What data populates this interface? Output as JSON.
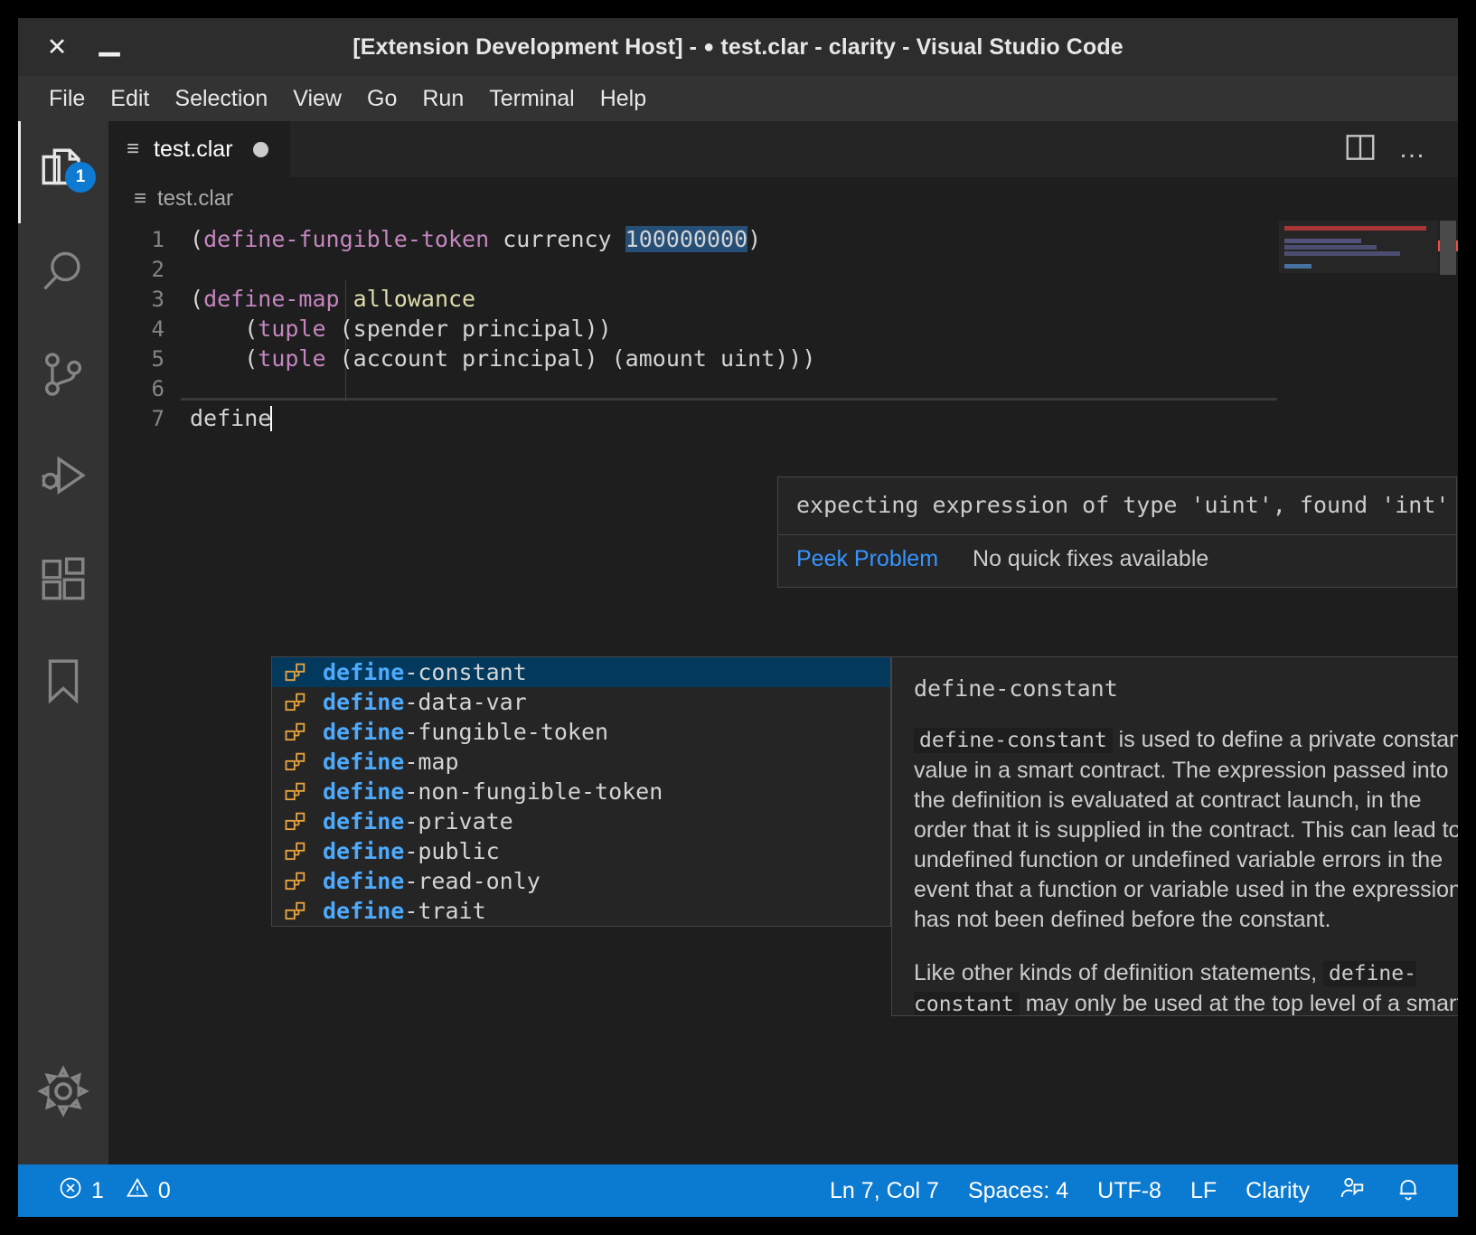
{
  "window": {
    "title_prefix": "[Extension Development Host] -",
    "dirty_marker": "●",
    "title_file": "test.clar - clarity - Visual Studio Code",
    "close_glyph": "✕",
    "minimize_glyph": "▁"
  },
  "menubar": {
    "items": [
      {
        "label": "File"
      },
      {
        "label": "Edit"
      },
      {
        "label": "Selection"
      },
      {
        "label": "View"
      },
      {
        "label": "Go"
      },
      {
        "label": "Run"
      },
      {
        "label": "Terminal"
      },
      {
        "label": "Help"
      }
    ]
  },
  "activitybar": {
    "items": [
      {
        "name": "explorer",
        "badge": "1"
      },
      {
        "name": "search",
        "badge": ""
      },
      {
        "name": "source-control",
        "badge": ""
      },
      {
        "name": "run-and-debug",
        "badge": ""
      },
      {
        "name": "extensions",
        "badge": ""
      },
      {
        "name": "bookmarks",
        "badge": ""
      }
    ],
    "bottom": [
      {
        "name": "manage-settings"
      }
    ]
  },
  "tabs": {
    "active": {
      "label": "test.clar",
      "dirty": true
    },
    "actions": {
      "split_editor": "split-editor-right",
      "more": "…"
    }
  },
  "breadcrumb": {
    "path": "test.clar"
  },
  "editor": {
    "lines": [
      {
        "no": "1",
        "text": "(define-fungible-token currency 100000000)"
      },
      {
        "no": "2",
        "text": ""
      },
      {
        "no": "3",
        "text": "(define-map allowance"
      },
      {
        "no": "4",
        "text": "    (tuple (spender principal))"
      },
      {
        "no": "5",
        "text": "    (tuple (account principal) (amount uint)))"
      },
      {
        "no": "6",
        "text": ""
      },
      {
        "no": "7",
        "text": "define"
      }
    ],
    "error_token": "100000000",
    "typed_prefix": "define"
  },
  "hover": {
    "message": "expecting expression of type 'uint', found 'int'",
    "peek_link": "Peek Problem",
    "quickfix_text": "No quick fixes available"
  },
  "suggest": {
    "items": [
      {
        "prefix": "define",
        "rest": "-constant",
        "selected": true
      },
      {
        "prefix": "define",
        "rest": "-data-var",
        "selected": false
      },
      {
        "prefix": "define",
        "rest": "-fungible-token",
        "selected": false
      },
      {
        "prefix": "define",
        "rest": "-map",
        "selected": false
      },
      {
        "prefix": "define",
        "rest": "-non-fungible-token",
        "selected": false
      },
      {
        "prefix": "define",
        "rest": "-private",
        "selected": false
      },
      {
        "prefix": "define",
        "rest": "-public",
        "selected": false
      },
      {
        "prefix": "define",
        "rest": "-read-only",
        "selected": false
      },
      {
        "prefix": "define",
        "rest": "-trait",
        "selected": false
      }
    ]
  },
  "docs": {
    "title": "define-constant",
    "close_glyph": "✕",
    "code_term": "define-constant",
    "para1_rest": " is used to define a private constant value in a smart contract. The expression passed into the definition is evaluated at contract launch, in the order that it is supplied in the contract. This can lead to undefined function or undefined variable errors in the event that a function or variable used in the expression has not been defined before the constant.",
    "para2_lead": "Like other kinds of definition statements, ",
    "para2_code": "define-constant",
    "para2_rest": " may only be used at the top level of a smart"
  },
  "statusbar": {
    "errors": "1",
    "warnings": "0",
    "position": "Ln 7, Col 7",
    "indentation": "Spaces: 4",
    "encoding": "UTF-8",
    "eol": "LF",
    "language": "Clarity",
    "feedback_icon": "feedback-smiley-icon",
    "notifications_icon": "bell-icon"
  },
  "colors": {
    "accent": "#0b7ad1",
    "titlebar": "#2d2d2d",
    "menubar": "#333333",
    "editor_bg": "#1e1e1e",
    "selection": "#264f78",
    "error": "#f14c4c",
    "suggest_selected": "#04395e",
    "keyword": "#c586c0",
    "number": "#b5cea8",
    "function": "#dcdcaa",
    "link": "#3794ff"
  }
}
